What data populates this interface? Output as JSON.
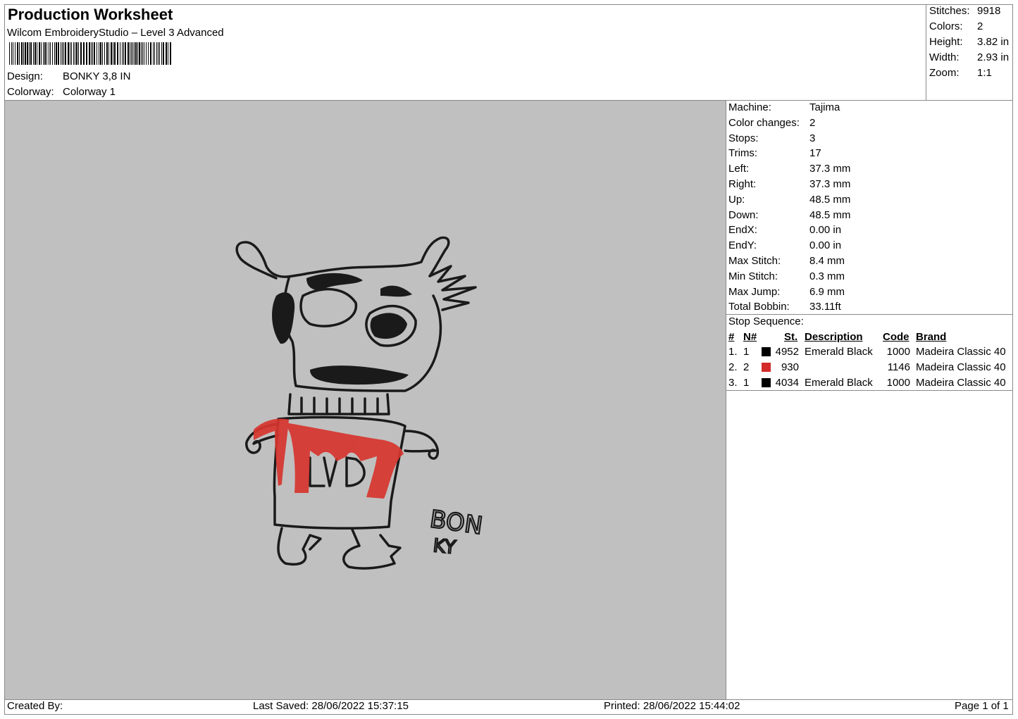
{
  "header": {
    "title": "Production Worksheet",
    "software": "Wilcom EmbroideryStudio – Level 3 Advanced",
    "design_label": "Design:",
    "design_value": "BONKY 3,8 IN",
    "colorway_label": "Colorway:",
    "colorway_value": "Colorway 1"
  },
  "stats": {
    "stitches_label": "Stitches:",
    "stitches_value": "9918",
    "colors_label": "Colors:",
    "colors_value": "2",
    "height_label": "Height:",
    "height_value": "3.82 in",
    "width_label": "Width:",
    "width_value": "2.93 in",
    "zoom_label": "Zoom:",
    "zoom_value": "1:1"
  },
  "machine": {
    "rows": [
      {
        "label": "Machine:",
        "value": "Tajima"
      },
      {
        "label": "Color changes:",
        "value": "2"
      },
      {
        "label": "Stops:",
        "value": "3"
      },
      {
        "label": "Trims:",
        "value": "17"
      },
      {
        "label": "Left:",
        "value": "37.3 mm"
      },
      {
        "label": "Right:",
        "value": "37.3 mm"
      },
      {
        "label": "Up:",
        "value": "48.5 mm"
      },
      {
        "label": "Down:",
        "value": "48.5 mm"
      },
      {
        "label": "EndX:",
        "value": "0.00 in"
      },
      {
        "label": "EndY:",
        "value": "0.00 in"
      },
      {
        "label": "Max Stitch:",
        "value": "8.4 mm"
      },
      {
        "label": "Min Stitch:",
        "value": "0.3 mm"
      },
      {
        "label": "Max Jump:",
        "value": "6.9 mm"
      },
      {
        "label": "Total Bobbin:",
        "value": "33.11ft"
      }
    ]
  },
  "stop_sequence": {
    "title": "Stop Sequence:",
    "headers": {
      "num": "#",
      "needle": "N#",
      "stitches": "St.",
      "description": "Description",
      "code": "Code",
      "brand": "Brand"
    },
    "rows": [
      {
        "num": "1.",
        "needle": "1",
        "color": "#000000",
        "stitches": "4952",
        "description": "Emerald Black",
        "code": "1000",
        "brand": "Madeira Classic 40"
      },
      {
        "num": "2.",
        "needle": "2",
        "color": "#d42a2a",
        "stitches": "930",
        "description": "",
        "code": "1146",
        "brand": "Madeira Classic 40"
      },
      {
        "num": "3.",
        "needle": "1",
        "color": "#000000",
        "stitches": "4034",
        "description": "Emerald Black",
        "code": "1000",
        "brand": "Madeira Classic 40"
      }
    ]
  },
  "design_preview": {
    "lettering_line1": "BON",
    "lettering_line2": "KY",
    "background_color": "#c0c0c0"
  },
  "footer": {
    "created_by": "Created By:",
    "last_saved": "Last Saved: 28/06/2022 15:37:15",
    "printed": "Printed: 28/06/2022 15:44:02",
    "page": "Page 1 of 1"
  }
}
